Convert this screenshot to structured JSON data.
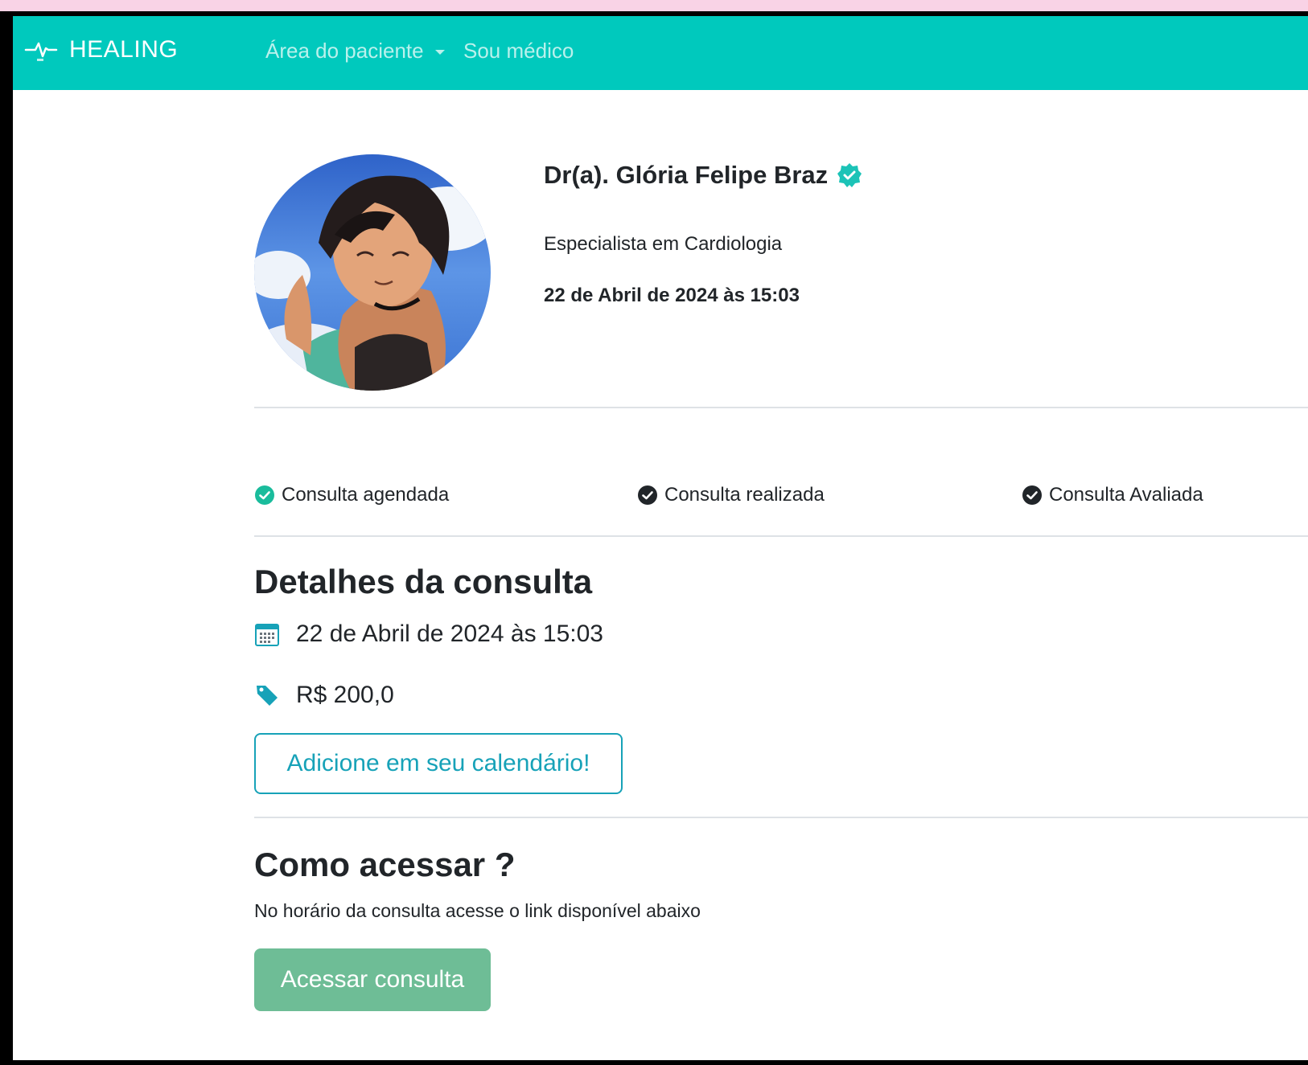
{
  "navbar": {
    "brand": "HEALING",
    "patient_area": "Área do paciente",
    "i_am_doctor": "Sou médico"
  },
  "doctor": {
    "name": "Dr(a). Glória Felipe Braz",
    "specialty": "Especialista em Cardiologia",
    "datetime": "22 de Abril de 2024 às 15:03"
  },
  "steps": [
    {
      "label": "Consulta agendada",
      "status": "done",
      "color": "#1abc9c"
    },
    {
      "label": "Consulta realizada",
      "status": "pending",
      "color": "#212529"
    },
    {
      "label": "Consulta Avaliada",
      "status": "pending",
      "color": "#212529"
    }
  ],
  "details": {
    "title": "Detalhes da consulta",
    "date": "22 de Abril de 2024 às 15:03",
    "price": "R$ 200,0",
    "calendar_button": "Adicione em seu calendário!"
  },
  "access": {
    "title": "Como acessar ?",
    "description": "No horário da consulta acesse o link disponível abaixo",
    "button": "Acessar consulta"
  },
  "colors": {
    "navbar": "#00c9bd",
    "accent": "#17a2b8",
    "access_button": "#6ebd96"
  }
}
